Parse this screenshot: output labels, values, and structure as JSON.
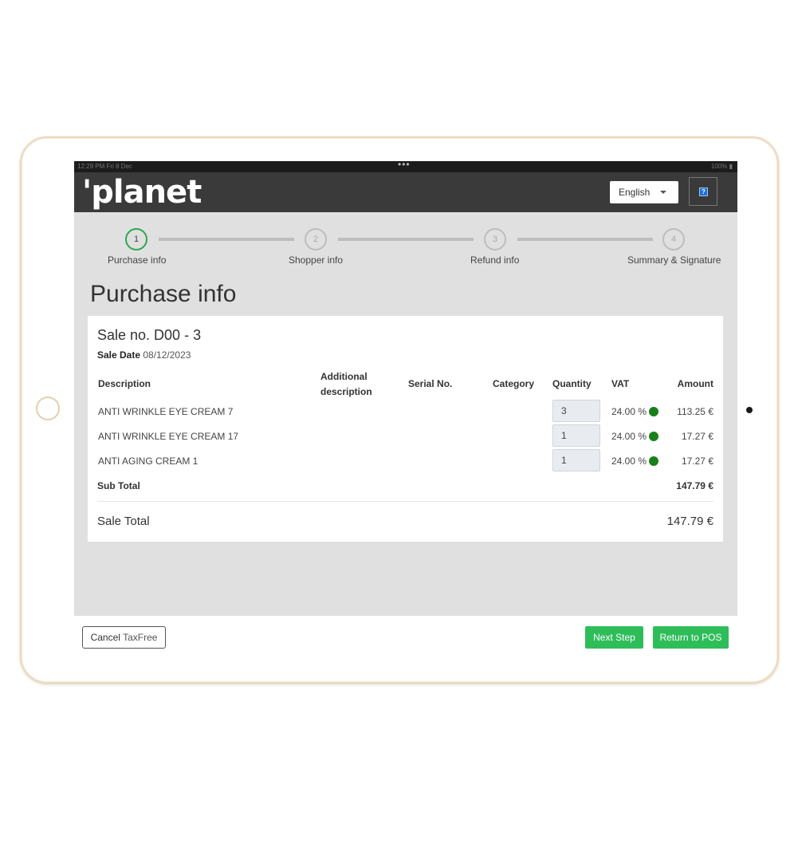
{
  "status_bar": {
    "left": "12:29 PM  Fri 8 Dec",
    "center": "•••",
    "right": "100% ▮"
  },
  "header": {
    "logo": "'planet",
    "language": "English",
    "help_icon": "help-icon"
  },
  "stepper": [
    {
      "num": "1",
      "label": "Purchase info",
      "active": true
    },
    {
      "num": "2",
      "label": "Shopper info",
      "active": false
    },
    {
      "num": "3",
      "label": "Refund info",
      "active": false
    },
    {
      "num": "4",
      "label": "Summary & Signature",
      "active": false
    }
  ],
  "page_title": "Purchase info",
  "sale": {
    "number": "Sale no. D00 - 3",
    "date_label": "Sale Date",
    "date": "08/12/2023"
  },
  "table": {
    "headers": {
      "description": "Description",
      "additional_1": "Additional",
      "additional_2": "description",
      "serial": "Serial No.",
      "category": "Category",
      "quantity": "Quantity",
      "vat": "VAT",
      "amount": "Amount"
    },
    "rows": [
      {
        "description": "ANTI WRINKLE EYE CREAM 7",
        "quantity": "3",
        "vat": "24.00 %",
        "amount": "113.25 €"
      },
      {
        "description": "ANTI WRINKLE EYE CREAM 17",
        "quantity": "1",
        "vat": "24.00 %",
        "amount": "17.27 €"
      },
      {
        "description": "ANTI AGING CREAM 1",
        "quantity": "1",
        "vat": "24.00 %",
        "amount": "17.27 €"
      }
    ],
    "sub_total_label": "Sub Total",
    "sub_total": "147.79 €"
  },
  "sale_total_label": "Sale Total",
  "sale_total": "147.79 €",
  "footer": {
    "cancel_part1": "Cancel",
    "cancel_part2": "TaxFree",
    "next": "Next Step",
    "return": "Return to POS"
  },
  "colors": {
    "accent_green": "#2ebd59",
    "vat_dot": "#1a7f1a",
    "header_bg": "#3a3a3a"
  }
}
